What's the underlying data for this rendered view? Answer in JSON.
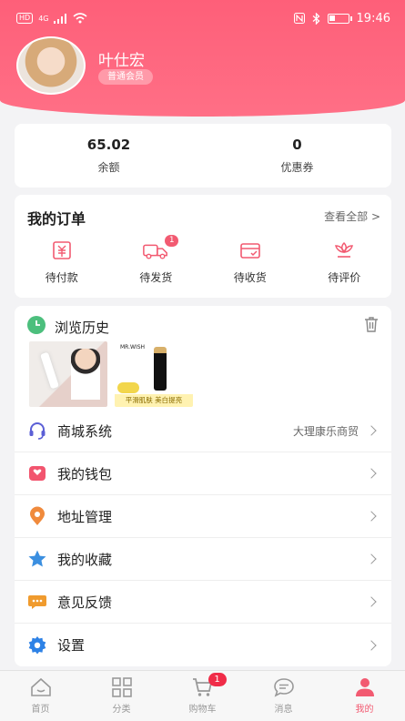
{
  "status_bar": {
    "left_badge": "HD",
    "signal": "4G",
    "time": "19:46"
  },
  "profile": {
    "name": "叶仕宏",
    "member_level": "普通会员"
  },
  "balance": [
    {
      "value": "65.02",
      "label": "余额"
    },
    {
      "value": "0",
      "label": "优惠券"
    }
  ],
  "orders": {
    "title": "我的订单",
    "view_all": "查看全部 >",
    "items": [
      {
        "label": "待付款",
        "icon": "payment-icon"
      },
      {
        "label": "待发货",
        "icon": "delivery-truck-icon",
        "badge": "1"
      },
      {
        "label": "待收货",
        "icon": "receive-box-icon"
      },
      {
        "label": "待评价",
        "icon": "review-flower-icon"
      }
    ]
  },
  "history": {
    "title": "浏览历史",
    "thumb_brand": "MR.WISH",
    "thumb_caption": "平滑肌肤 美白提亮"
  },
  "menu": [
    {
      "label": "商城系统",
      "value": "大理康乐商贸",
      "icon": "headset-icon"
    },
    {
      "label": "我的钱包",
      "value": "",
      "icon": "wallet-icon"
    },
    {
      "label": "地址管理",
      "value": "",
      "icon": "location-pin-icon"
    },
    {
      "label": "我的收藏",
      "value": "",
      "icon": "star-icon"
    },
    {
      "label": "意见反馈",
      "value": "",
      "icon": "chat-bubble-icon"
    },
    {
      "label": "设置",
      "value": "",
      "icon": "gear-icon"
    }
  ],
  "tabbar": [
    {
      "label": "首页",
      "icon": "home-icon"
    },
    {
      "label": "分类",
      "icon": "grid-icon"
    },
    {
      "label": "购物车",
      "icon": "cart-icon",
      "badge": "1"
    },
    {
      "label": "消息",
      "icon": "message-icon"
    },
    {
      "label": "我的",
      "icon": "profile-icon",
      "active": true
    }
  ],
  "colors": {
    "primary": "#f25a71",
    "header": "#fe5f79",
    "badge": "#f02c48"
  }
}
